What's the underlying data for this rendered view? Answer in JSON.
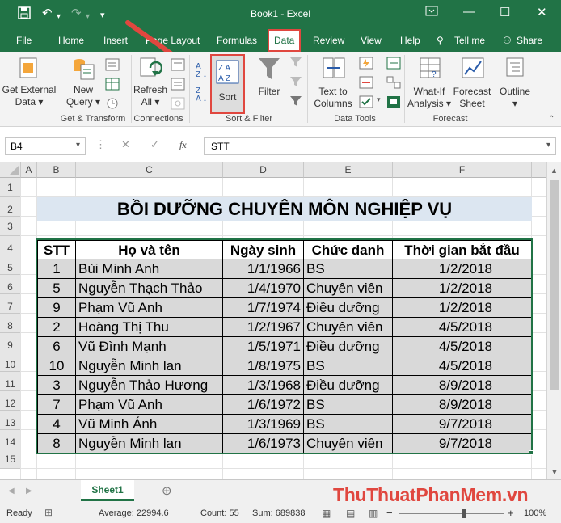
{
  "app": {
    "title": "Book1  -  Excel",
    "accent": "#217346",
    "highlight": "#e0473f"
  },
  "tabs": [
    "File",
    "Home",
    "Insert",
    "Page Layout",
    "Formulas",
    "Data",
    "Review",
    "View",
    "Help",
    "Tell me",
    "Share"
  ],
  "ribbon": {
    "get_external_1": "Get External",
    "get_external_2": "Data",
    "new_query_1": "New",
    "new_query_2": "Query",
    "refresh_1": "Refresh",
    "refresh_2": "All",
    "sort": "Sort",
    "filter": "Filter",
    "text_to_columns_1": "Text to",
    "text_to_columns_2": "Columns",
    "what_if_1": "What-If",
    "what_if_2": "Analysis",
    "forecast_1": "Forecast",
    "forecast_2": "Sheet",
    "outline": "Outline",
    "groups": [
      "Get & Transform",
      "Connections",
      "Sort & Filter",
      "Data Tools",
      "Forecast"
    ]
  },
  "formula_bar": {
    "name_box": "B4",
    "fx": "fx",
    "content": "STT"
  },
  "columns": [
    "A",
    "B",
    "C",
    "D",
    "E",
    "F"
  ],
  "rows": [
    "1",
    "2",
    "3",
    "4",
    "5",
    "6",
    "7",
    "8",
    "9",
    "10",
    "11",
    "12",
    "13",
    "14",
    "15"
  ],
  "sheet": {
    "title": "BỒI DƯỠNG CHUYÊN MÔN NGHIỆP VỤ",
    "headers": [
      "STT",
      "Họ và tên",
      "Ngày sinh",
      "Chức danh",
      "Thời gian bắt đầu"
    ],
    "data": [
      [
        "1",
        "Bùi Minh Anh",
        "1/1/1966",
        "BS",
        "1/2/2018"
      ],
      [
        "5",
        "Nguyễn Thạch Thảo",
        "1/4/1970",
        "Chuyên viên",
        "1/2/2018"
      ],
      [
        "9",
        "Phạm Vũ Anh",
        "1/7/1974",
        "Điều dưỡng",
        "1/2/2018"
      ],
      [
        "2",
        "Hoàng Thị Thu",
        "1/2/1967",
        "Chuyên viên",
        "4/5/2018"
      ],
      [
        "6",
        "Vũ Đình Mạnh",
        "1/5/1971",
        "Điều dưỡng",
        "4/5/2018"
      ],
      [
        "10",
        "Nguyễn Minh lan",
        "1/8/1975",
        "BS",
        "4/5/2018"
      ],
      [
        "3",
        "Nguyễn Thảo Hương",
        "1/3/1968",
        "Điều dưỡng",
        "8/9/2018"
      ],
      [
        "7",
        "Phạm Vũ Anh",
        "1/6/1972",
        "BS",
        "8/9/2018"
      ],
      [
        "4",
        "Vũ Minh Ánh",
        "1/3/1969",
        "BS",
        "9/7/2018"
      ],
      [
        "8",
        "Nguyễn Minh lan",
        "1/6/1973",
        "Chuyên viên",
        "9/7/2018"
      ]
    ]
  },
  "sheet_tab": "Sheet1",
  "watermark": "ThuThuatPhanMem.vn",
  "status": {
    "ready": "Ready",
    "average": "Average: 22994.6",
    "count": "Count: 55",
    "sum": "Sum: 689838",
    "zoom": "100%"
  }
}
